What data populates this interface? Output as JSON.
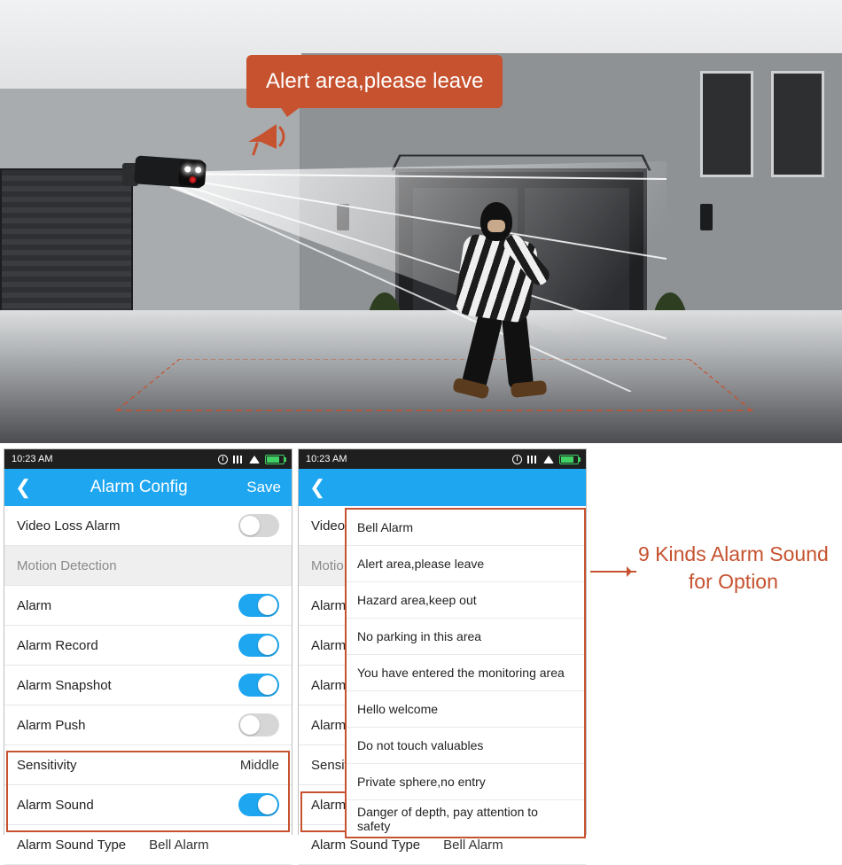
{
  "hero": {
    "bubble_text": "Alert area,please leave"
  },
  "status": {
    "time": "10:23 AM"
  },
  "nav": {
    "title": "Alarm Config",
    "save": "Save"
  },
  "rows": {
    "video_loss": "Video Loss Alarm",
    "motion_section": "Motion Detection",
    "alarm": "Alarm",
    "alarm_record": "Alarm Record",
    "alarm_snapshot": "Alarm Snapshot",
    "alarm_push": "Alarm Push",
    "sensitivity": "Sensitivity",
    "sensitivity_value": "Middle",
    "alarm_sound": "Alarm Sound",
    "alarm_sound_type": "Alarm Sound Type",
    "alarm_sound_type_value": "Bell Alarm"
  },
  "phone2": {
    "video_short": "Video",
    "motion_short": "Motio",
    "alarm_short_a": "Alarm",
    "alarm_short_b": "Alarm",
    "alarm_short_c": "Alarm",
    "alarm_short_d": "Alarm",
    "sens_short": "Sensit",
    "alarm_short_e": "Alarm"
  },
  "dropdown": [
    "Bell Alarm",
    "Alert area,please leave",
    "Hazard area,keep out",
    "No parking in this area",
    "You have entered the monitoring area",
    "Hello welcome",
    "Do not touch valuables",
    "Private sphere,no entry",
    "Danger of depth, pay attention to safety"
  ],
  "callout": {
    "line1": "9 Kinds Alarm Sound",
    "line2": "for Option"
  }
}
